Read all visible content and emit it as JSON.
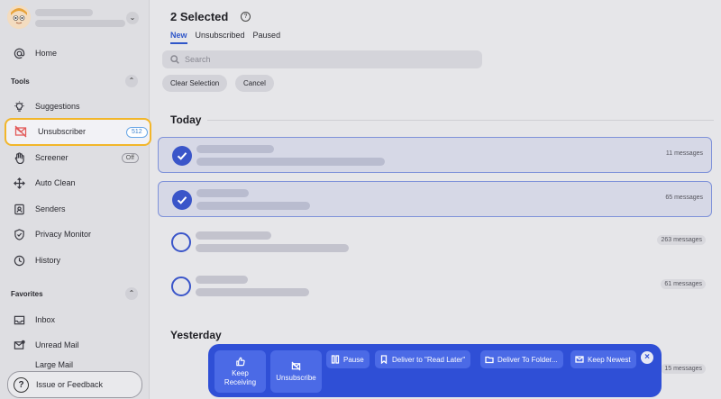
{
  "sidebar": {
    "home_label": "Home",
    "tools_label": "Tools",
    "favorites_label": "Favorites",
    "items": {
      "suggestions": "Suggestions",
      "unsubscriber": "Unsubscriber",
      "screener": "Screener",
      "auto_clean": "Auto Clean",
      "senders": "Senders",
      "privacy_monitor": "Privacy Monitor",
      "history": "History"
    },
    "unsubscriber_count": "512",
    "screener_status": "Off",
    "favorites": {
      "inbox": "Inbox",
      "unread_mail": "Unread Mail",
      "large_mail": "Large Mail"
    },
    "feedback_label": "Issue or Feedback",
    "feedback_glyph": "?"
  },
  "header": {
    "title": "2 Selected",
    "tabs": [
      "New",
      "Unsubscribed",
      "Paused"
    ]
  },
  "search": {
    "placeholder": "Search"
  },
  "buttons": {
    "clear_selection": "Clear Selection",
    "cancel": "Cancel"
  },
  "groups": {
    "today": "Today",
    "yesterday": "Yesterday"
  },
  "rows": [
    {
      "selected": true,
      "messages": "11 messages"
    },
    {
      "selected": true,
      "messages": "65 messages"
    },
    {
      "selected": false,
      "messages": "263 messages"
    },
    {
      "selected": false,
      "messages": "61 messages"
    },
    {
      "selected": false,
      "messages": "15 messages"
    }
  ],
  "action_bar": {
    "keep_receiving": "Keep Receiving",
    "unsubscribe": "Unsubscribe",
    "pause": "Pause",
    "deliver_read_later": "Deliver to \"Read Later\"",
    "deliver_folder": "Deliver To Folder...",
    "keep_newest": "Keep Newest"
  },
  "colors": {
    "accent": "#2f4fd6",
    "highlight": "#f2b62a",
    "badge": "#3e82cf"
  }
}
